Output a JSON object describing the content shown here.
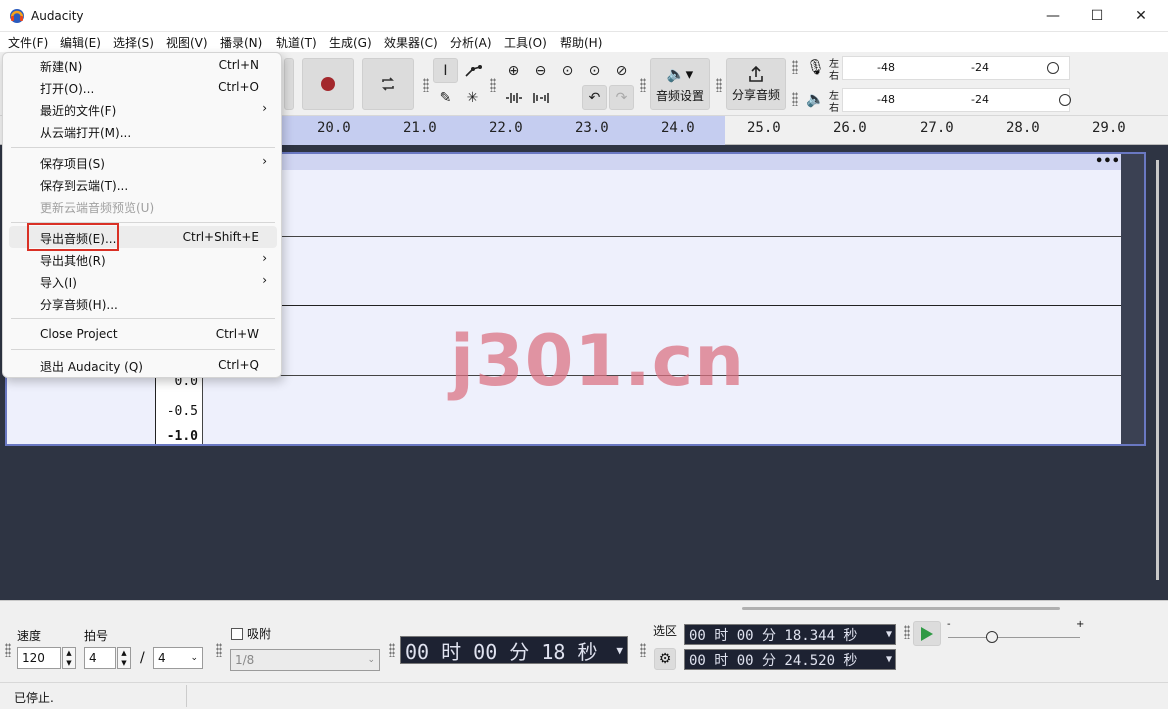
{
  "window": {
    "title": "Audacity",
    "controls": {
      "minimize": "—",
      "maximize": "☐",
      "close": "✕"
    }
  },
  "menubar": [
    "文件(F)",
    "编辑(E)",
    "选择(S)",
    "视图(V)",
    "播录(N)",
    "轨道(T)",
    "生成(G)",
    "效果器(C)",
    "分析(A)",
    "工具(O)",
    "帮助(H)"
  ],
  "toolbar": {
    "audio_setup_label": "音频设置",
    "share_audio_label": "分享音频",
    "meter_rec": {
      "left": "左",
      "right": "右",
      "ticks": [
        "-48",
        "-24"
      ]
    },
    "meter_play": {
      "left": "左",
      "right": "右",
      "ticks": [
        "-48",
        "-24"
      ]
    }
  },
  "ruler": {
    "ticks": [
      "20.0",
      "21.0",
      "22.0",
      "23.0",
      "24.0",
      "25.0",
      "26.0",
      "27.0",
      "28.0",
      "29.0"
    ]
  },
  "track": {
    "menu": "•••",
    "scale": [
      "0.0",
      "-0.5",
      "-1.0"
    ]
  },
  "file_menu": {
    "items": [
      {
        "label": "新建(N)",
        "shortcut": "Ctrl+N",
        "submenu": false,
        "disabled": false
      },
      {
        "label": "打开(O)...",
        "shortcut": "Ctrl+O",
        "submenu": false,
        "disabled": false
      },
      {
        "label": "最近的文件(F)",
        "shortcut": "",
        "submenu": true,
        "disabled": false
      },
      {
        "label": "从云端打开(M)...",
        "shortcut": "",
        "submenu": false,
        "disabled": false
      },
      {
        "label": "保存项目(S)",
        "shortcut": "",
        "submenu": true,
        "disabled": false
      },
      {
        "label": "保存到云端(T)...",
        "shortcut": "",
        "submenu": false,
        "disabled": false
      },
      {
        "label": "更新云端音频预览(U)",
        "shortcut": "",
        "submenu": false,
        "disabled": true
      },
      {
        "label": "导出音频(E)...",
        "shortcut": "Ctrl+Shift+E",
        "submenu": false,
        "disabled": false
      },
      {
        "label": "导出其他(R)",
        "shortcut": "",
        "submenu": true,
        "disabled": false
      },
      {
        "label": "导入(I)",
        "shortcut": "",
        "submenu": true,
        "disabled": false
      },
      {
        "label": "分享音频(H)...",
        "shortcut": "",
        "submenu": false,
        "disabled": false
      },
      {
        "label": "Close Project",
        "shortcut": "Ctrl+W",
        "submenu": false,
        "disabled": false
      },
      {
        "label": "退出 Audacity (Q)",
        "shortcut": "Ctrl+Q",
        "submenu": false,
        "disabled": false
      }
    ],
    "highlight_color": "#d93025"
  },
  "bottom": {
    "tempo_label": "速度",
    "tempo_value": "120",
    "beats_label": "拍号",
    "beats_value": "4",
    "beats_sep": "/",
    "beats_denominator": "4",
    "snap_label": "吸附",
    "snap_value": "1/8",
    "time_display": "00 时 00 分 18 秒",
    "selection_label": "选区",
    "selection_start": "00 时 00 分 18.344 秒",
    "selection_end": "00 时 00 分 24.520 秒",
    "play_speed_minus": "-",
    "play_speed_plus": "+"
  },
  "status": {
    "text": "已停止."
  },
  "watermark": "j301.cn",
  "colors": {
    "track_bg": "#eef0fc",
    "track_border": "#6a78c2",
    "ruler_selection": "#c5cdf0",
    "record": "#a3282d",
    "background_dark": "#2e3443"
  }
}
